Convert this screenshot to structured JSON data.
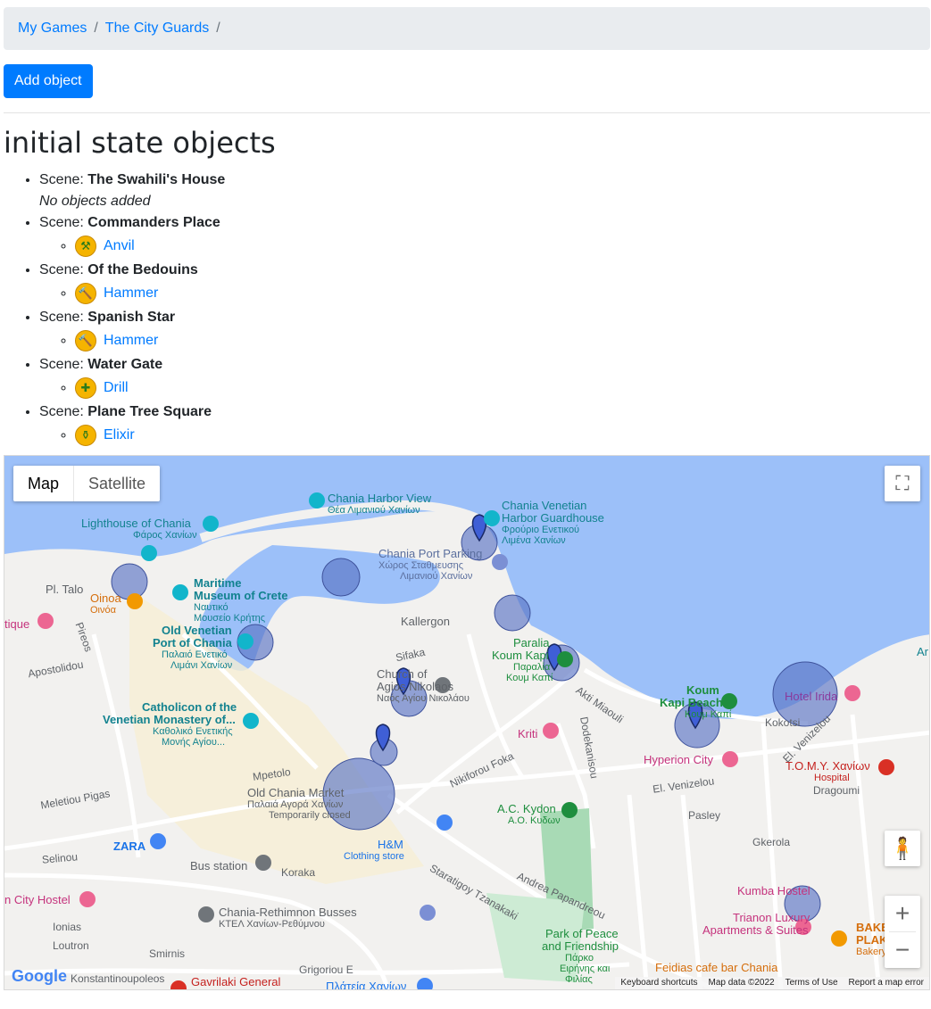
{
  "breadcrumb": {
    "items": [
      "My Games",
      "The City Guards"
    ],
    "sep": "/"
  },
  "actions": {
    "add_object": "Add object"
  },
  "title": "initial state objects",
  "scene_label": "Scene:",
  "scenes": [
    {
      "name": "The Swahili's House",
      "empty_text": "No objects added",
      "objects": []
    },
    {
      "name": "Commanders Place",
      "objects": [
        {
          "label": "Anvil",
          "icon": "anvil-icon"
        }
      ]
    },
    {
      "name": "Of the Bedouins",
      "objects": [
        {
          "label": "Hammer",
          "icon": "hammer-icon"
        }
      ]
    },
    {
      "name": "Spanish Star",
      "objects": [
        {
          "label": "Hammer",
          "icon": "hammer-icon"
        }
      ]
    },
    {
      "name": "Water Gate",
      "objects": [
        {
          "label": "Drill",
          "icon": "drill-icon"
        }
      ]
    },
    {
      "name": "Plane Tree Square",
      "objects": [
        {
          "label": "Elixir",
          "icon": "elixir-icon"
        }
      ]
    }
  ],
  "map": {
    "type_options": [
      "Map",
      "Satellite"
    ],
    "selected_type": "Map",
    "footer": [
      "Keyboard shortcuts",
      "Map data ©2022",
      "Terms of Use",
      "Report a map error"
    ],
    "logo": "Google",
    "labels": {
      "harbor_view": "Chania Harbor View",
      "harbor_view_gr": "Θέα Λιμανιού Χανίων",
      "guardhouse": "Chania Venetian",
      "guardhouse2": "Harbor Guardhouse",
      "guardhouse_gr": "Φρούριο Ενετικού",
      "guardhouse_gr2": "Λιμένα Χανίων",
      "lighthouse": "Lighthouse of Chania",
      "lighthouse_gr": "Φάρος Χανίων",
      "port_parking": "Chania Port Parking",
      "port_parking_gr": "Χώρος Σταθμευσης",
      "port_parking_gr2": "Λιμανιού Χανίων",
      "maritime": "Maritime",
      "maritime2": "Museum of Crete",
      "maritime_gr": "Ναυτικό",
      "maritime_gr2": "Μουσείο Κρήτης",
      "pl_talo": "Pl. Talo",
      "oinoa": "Oinoa",
      "oinoa_gr": "Οινόα",
      "old_port": "Old Venetian",
      "old_port2": "Port of Chania",
      "old_port_gr": "Παλαιό Ενετικό",
      "old_port_gr2": "Λιμάνι Χανίων",
      "kallergon": "Kallergon",
      "paralia": "Paralia",
      "paralia2": "Koum Kapi",
      "paralia_gr": "Παραλία",
      "paralia_gr2": "Κουμ Καπί",
      "church": "Church of",
      "church2": "Agios Nikolaos",
      "church_gr": "Ναός Αγίου Νικολάου",
      "koum_kapi": "Koum",
      "koum_kapi2": "Kapi Beach",
      "koum_kapi_gr": "Κουμ Καπί",
      "hotel_irida": "Hotel Irida",
      "catholicon": "Catholicon of the",
      "catholicon2": "Venetian Monastery of...",
      "catholicon_gr": "Καθολικό Ενετικής",
      "catholicon_gr2": "Μονής Αγίου...",
      "kriti": "Kriti",
      "hyperion": "Hyperion City",
      "tomy": "T.O.M.Y. Χανίων",
      "tomy_sub": "Hospital",
      "market": "Old Chania Market",
      "market_gr": "Παλαιά Αγορά Χανίων",
      "market_sub": "Temporarily closed",
      "akydon": "A.C. Kydon",
      "akydon_gr": "Α.Ο. Κυδων",
      "zara": "ZARA",
      "hm": "H&M",
      "hm_sub": "Clothing store",
      "bus": "Bus station",
      "kumba": "Kumba Hostel",
      "trianon": "Trianon Luxury",
      "trianon2": "Apartments & Suites",
      "busses": "Chania-Rethimnon Busses",
      "busses_gr": "ΚΤΕΛ Χανίων-Ρεθύμνου",
      "park": "Park of Peace",
      "park2": "and Friendship",
      "park_gr": "Πάρκο",
      "park_gr2": "Ειρήνης και",
      "park_gr3": "Φιλίας",
      "feidias": "Feidias cafe bar Chania",
      "city_hostel": "n City Hostel",
      "gavrilaki": "Gavrilaki General",
      "street_aktimiaouli": "Akti Miaouli",
      "street_elvenizelou": "El. Venizelou",
      "street_andrea": "Andrea Papandreou",
      "street_staratigoy": "Staratigoy Tzanakaki",
      "street_nikiforou": "Nikiforou Foka",
      "street_dodekanisou": "Dodekanisou",
      "street_dragoumi": "Dragoumi",
      "street_pasley": "Pasley",
      "street_gkerola": "Gkerola",
      "street_koraka": "Koraka",
      "street_selinou": "Selinou",
      "street_apostolidou": "Apostolidou",
      "street_mpetolo": "Mpetolo",
      "street_meletiou": "Meletiou Pigas",
      "street_kokotsi": "Kokotsi",
      "street_sifaka": "Sifaka",
      "street_pireos": "Pireos",
      "street_ionias": "Ionias",
      "street_loutron": "Loutron",
      "street_smirnis": "Smirnis",
      "street_grigoriou": "Grigoriou E",
      "street_konstantinoupoleos": "Konstantinoupoleos",
      "bake": "BAKE",
      "bake2": "PLAKO",
      "bake_sub": "Bakery",
      "tique": "tique",
      "plateia": "Πλάτεία Χανίων",
      "ar": "Ar"
    }
  },
  "colors": {
    "link": "#007bff",
    "primary": "#007bff",
    "water": "#9cc0f9",
    "circle": "#5a74c5"
  }
}
